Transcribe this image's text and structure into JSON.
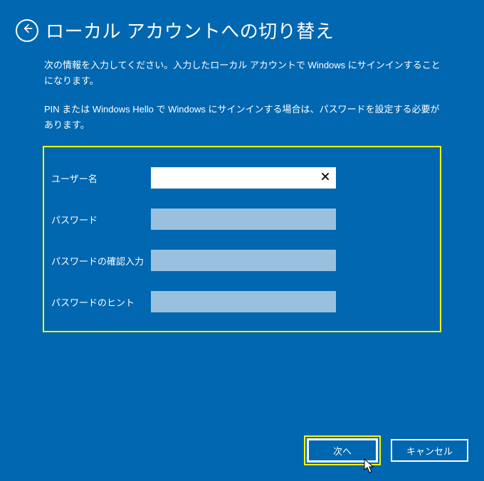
{
  "header": {
    "title": "ローカル アカウントへの切り替え"
  },
  "description": {
    "p1": "次の情報を入力してください。入力したローカル アカウントで Windows にサインインすることになります。",
    "p2": "PIN または Windows Hello で Windows にサインインする場合は、パスワードを設定する必要があります。"
  },
  "form": {
    "username": {
      "label": "ユーザー名",
      "value": ""
    },
    "password": {
      "label": "パスワード",
      "value": ""
    },
    "password_confirm": {
      "label": "パスワードの確認入力",
      "value": ""
    },
    "password_hint": {
      "label": "パスワードのヒント",
      "value": ""
    }
  },
  "footer": {
    "next_label": "次へ",
    "cancel_label": "キャンセル"
  }
}
